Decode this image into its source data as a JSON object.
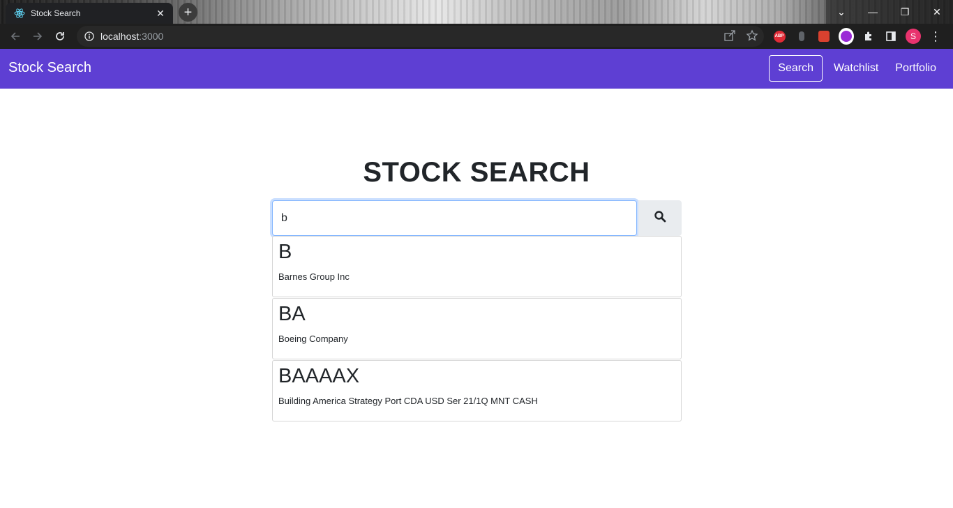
{
  "browser": {
    "tab_title": "Stock Search",
    "url_host": "localhost",
    "url_port": ":3000",
    "new_tab_symbol": "+",
    "tab_close_symbol": "✕",
    "window_controls": [
      "⌄",
      "—",
      "❐",
      "✕"
    ],
    "extensions": [
      "abp-icon",
      "ext-gray-icon",
      "ext-red-icon",
      "ext-purple-icon",
      "puzzle-icon",
      "side-panel-icon"
    ],
    "abp_label": "ABP",
    "profile_initial": "S",
    "menu_symbol": "⋮"
  },
  "app": {
    "brand": "Stock Search",
    "nav": {
      "search": "Search",
      "watchlist": "Watchlist",
      "portfolio": "Portfolio"
    },
    "accent_color": "#5e3fd3"
  },
  "main": {
    "title": "STOCK SEARCH",
    "search_value": "b",
    "search_button_icon": "search-icon",
    "results": [
      {
        "symbol": "B",
        "name": "Barnes Group Inc"
      },
      {
        "symbol": "BA",
        "name": "Boeing Company"
      },
      {
        "symbol": "BAAAAX",
        "name": "Building America Strategy Port CDA USD Ser 21/1Q MNT CASH"
      }
    ]
  }
}
